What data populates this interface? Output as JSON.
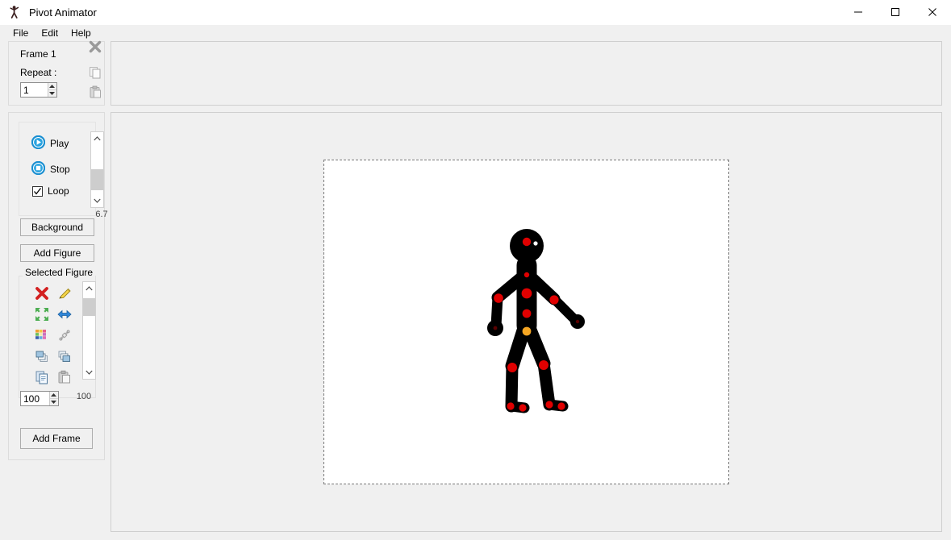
{
  "window": {
    "title": "Pivot Animator",
    "app_icon": "stick-figure-icon",
    "controls": {
      "minimize": "minimize-icon",
      "maximize": "maximize-icon",
      "close": "close-icon"
    }
  },
  "menubar": {
    "items": [
      {
        "label": "File"
      },
      {
        "label": "Edit"
      },
      {
        "label": "Help"
      }
    ]
  },
  "frame_panel": {
    "frame_label": "Frame 1",
    "repeat_label": "Repeat :",
    "repeat_value": "1",
    "delete_icon": "delete-x-icon",
    "copy_icon": "copy-icon",
    "paste_icon": "paste-icon"
  },
  "playback": {
    "play_label": "Play",
    "stop_label": "Stop",
    "loop_label": "Loop",
    "loop_checked": true,
    "play_icon": "play-circle-icon",
    "stop_icon": "stop-circle-icon",
    "speed_value": "6.7"
  },
  "buttons": {
    "background": "Background",
    "add_figure": "Add Figure",
    "add_frame": "Add Frame"
  },
  "selected_figure": {
    "title": "Selected Figure",
    "icons": [
      {
        "name": "delete-figure-icon",
        "glyph": "red-x"
      },
      {
        "name": "edit-figure-icon",
        "glyph": "pencil"
      },
      {
        "name": "resize-figure-icon",
        "glyph": "green-arrows"
      },
      {
        "name": "flip-figure-icon",
        "glyph": "blue-flip-arrows"
      },
      {
        "name": "figure-colour-icon",
        "glyph": "colour-palette"
      },
      {
        "name": "link-figure-icon",
        "glyph": "chain-link"
      },
      {
        "name": "bring-to-front-icon",
        "glyph": "front-layers"
      },
      {
        "name": "send-to-back-icon",
        "glyph": "back-layers"
      },
      {
        "name": "copy-figure-icon",
        "glyph": "copy-pages"
      },
      {
        "name": "paste-figure-icon",
        "glyph": "paste-clipboard"
      }
    ],
    "scale_value": "100",
    "scale_scroll_value": "100"
  },
  "canvas": {
    "background_colour": "#ffffff",
    "border_style": "dashed",
    "figure": {
      "name": "stick-figure",
      "body_colour": "#000000",
      "joint_colour": "#e00000",
      "pivot_colour": "#f5a623",
      "eye_colour": "#ffffff"
    }
  }
}
